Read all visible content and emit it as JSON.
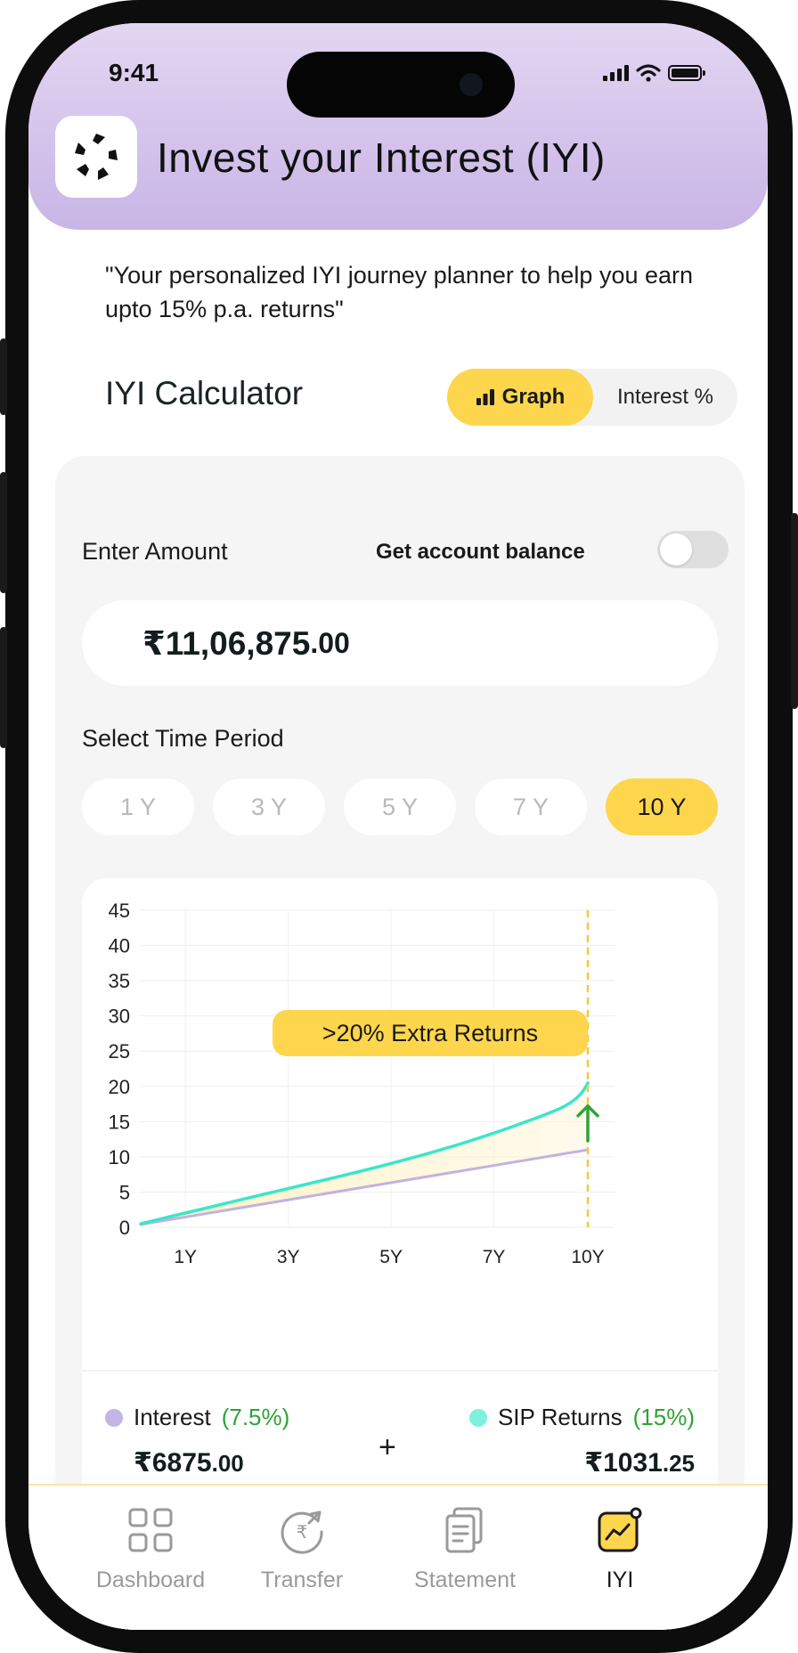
{
  "status_bar": {
    "time": "9:41"
  },
  "header": {
    "title": "Invest your Interest (IYI)"
  },
  "tagline": "\"Your personalized IYI journey planner to help you earn upto 15% p.a. returns\"",
  "calculator": {
    "title": "IYI Calculator",
    "view_toggle": {
      "graph_label": "Graph",
      "interest_label": "Interest %",
      "selected": "Graph"
    },
    "enter_amount_label": "Enter Amount",
    "account_balance_label": "Get account balance",
    "account_balance_enabled": false,
    "amount": {
      "main": "₹11,06,875",
      "decimals": ".00"
    },
    "time_period_label": "Select Time Period",
    "periods": [
      {
        "label": "1 Y",
        "active": false
      },
      {
        "label": "3 Y",
        "active": false
      },
      {
        "label": "5 Y",
        "active": false
      },
      {
        "label": "7 Y",
        "active": false
      },
      {
        "label": "10 Y",
        "active": true
      }
    ]
  },
  "chart_data": {
    "type": "line",
    "y_ticks": [
      "0",
      "5",
      "10",
      "15",
      "20",
      "25",
      "30",
      "35",
      "40",
      "45"
    ],
    "x_tick_labels": [
      "1Y",
      "3Y",
      "5Y",
      "7Y",
      "10Y"
    ],
    "ylim": [
      0,
      45
    ],
    "annotation": ">20% Extra Returns",
    "series": [
      {
        "key": "sip",
        "color": "#3be6c9",
        "points": [
          [
            0,
            0.5
          ],
          [
            1.3,
            2.5
          ],
          [
            3.3,
            5.5
          ],
          [
            5.3,
            8.5
          ],
          [
            7.3,
            12
          ],
          [
            9.3,
            16.5
          ],
          [
            9.7,
            18
          ],
          [
            9.9,
            19.3
          ],
          [
            10,
            20.5
          ]
        ]
      },
      {
        "key": "interest",
        "color": "#c2b2e3",
        "points": [
          [
            0,
            0.4
          ],
          [
            10,
            11
          ]
        ]
      }
    ]
  },
  "legend": {
    "interest": {
      "label": "Interest",
      "pct": "(7.5%)",
      "value_main": "₹6875",
      "value_dec": ".00",
      "color": "#c3b5e6"
    },
    "plus": "+",
    "sip": {
      "label": "SIP Returns",
      "pct": "(15%)",
      "value_main": "₹1031",
      "value_dec": ".25",
      "color": "#7ef0dc"
    }
  },
  "nav": {
    "items": [
      {
        "label": "Dashboard",
        "active": false
      },
      {
        "label": "Transfer",
        "active": false
      },
      {
        "label": "Statement",
        "active": false
      },
      {
        "label": "IYI",
        "active": true
      }
    ]
  },
  "colors": {
    "accent_yellow": "#fdd64d",
    "header_purple": "#c9b5e6",
    "positive_green": "#2fa334"
  }
}
